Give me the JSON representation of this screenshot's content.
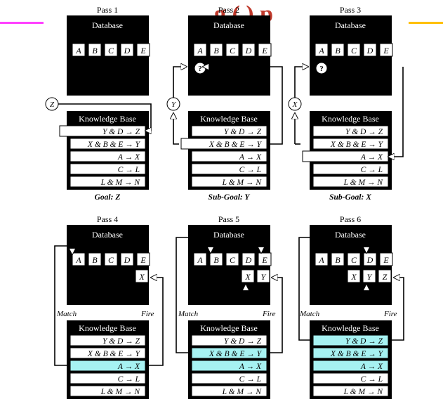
{
  "header_title_fragment": "g ( ) p",
  "colors": {
    "accent_magenta": "#ff40ff",
    "accent_orange": "#ffc000",
    "title_red": "#c0392b",
    "highlight": "#a6f2f2",
    "panel": "#000000"
  },
  "labels": {
    "database": "Database",
    "knowledge_base": "Knowledge Base",
    "match": "Match",
    "fire": "Fire"
  },
  "facts": [
    "A",
    "B",
    "C",
    "D",
    "E"
  ],
  "unknown_symbol": "?",
  "rules": [
    "Y & D → Z",
    "X & B & E → Y",
    "A → X",
    "C → L",
    "L & M → N"
  ],
  "passes": [
    {
      "label": "Pass 1",
      "goal_prefix": "Goal:",
      "goal_value": "Z",
      "goal_symbol": "Z"
    },
    {
      "label": "Pass 2",
      "goal_prefix": "Sub-Goal:",
      "goal_value": "Y",
      "goal_symbol": "Y"
    },
    {
      "label": "Pass 3",
      "goal_prefix": "Sub-Goal:",
      "goal_value": "X",
      "goal_symbol": "X"
    },
    {
      "label": "Pass 4",
      "derived": [
        "X"
      ]
    },
    {
      "label": "Pass 5",
      "derived": [
        "X",
        "Y"
      ]
    },
    {
      "label": "Pass 6",
      "derived": [
        "X",
        "Y",
        "Z"
      ]
    }
  ]
}
